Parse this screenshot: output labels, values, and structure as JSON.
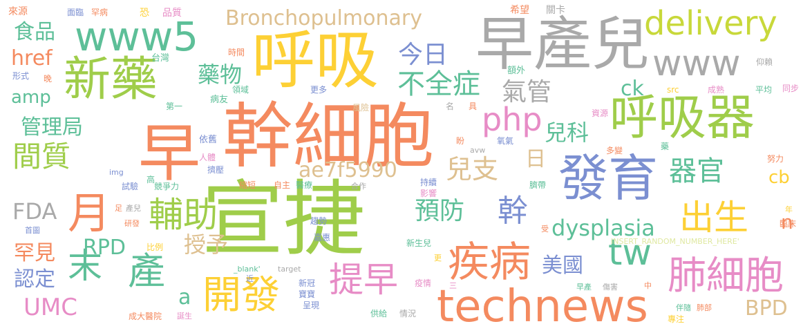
{
  "word_cloud": {
    "words": [
      {
        "text": "幹細胞",
        "color": "#f48a5f"
      },
      {
        "text": "宣捷",
        "color": "#9fcd4a"
      },
      {
        "text": "早產兒",
        "color": "#a9a9a9"
      },
      {
        "text": "呼吸",
        "color": "#fdd035"
      },
      {
        "text": "新藥",
        "color": "#9fcd4a"
      },
      {
        "text": "www5",
        "color": "#5dbf98"
      },
      {
        "text": "www",
        "color": "#a9a9a9"
      },
      {
        "text": "呼吸器",
        "color": "#9fcd4a"
      },
      {
        "text": "發育",
        "color": "#7b8fd1"
      },
      {
        "text": "technews",
        "color": "#f48a5f"
      },
      {
        "text": "早",
        "color": "#f48a5f"
      },
      {
        "text": "delivery",
        "color": "#c8d83a"
      },
      {
        "text": "tw",
        "color": "#5dbf98"
      },
      {
        "text": "疾病",
        "color": "#f48a5f"
      },
      {
        "text": "肺細胞",
        "color": "#e78cc6"
      },
      {
        "text": "開發",
        "color": "#fdd035"
      },
      {
        "text": "輔助",
        "color": "#9fcd4a"
      },
      {
        "text": "器官",
        "color": "#5dbf98"
      },
      {
        "text": "出生",
        "color": "#fdd035"
      },
      {
        "text": "月",
        "color": "#f48a5f"
      },
      {
        "text": "提早",
        "color": "#e78cc6"
      },
      {
        "text": "php",
        "color": "#e78cc6"
      },
      {
        "text": "Bronchopulmonary",
        "color": "#dec090"
      },
      {
        "text": "間質",
        "color": "#9fcd4a"
      },
      {
        "text": "末",
        "color": "#5dbf98"
      },
      {
        "text": "產",
        "color": "#5dbf98"
      },
      {
        "text": "幹",
        "color": "#7b8fd1"
      },
      {
        "text": "不全症",
        "color": "#5dbf98"
      },
      {
        "text": "今日",
        "color": "#7b8fd1"
      },
      {
        "text": "氣管",
        "color": "#a9a9a9"
      },
      {
        "text": "藥物",
        "color": "#5dbf98"
      },
      {
        "text": "dysplasia",
        "color": "#5dbf98"
      },
      {
        "text": "兒支",
        "color": "#dec090"
      },
      {
        "text": "兒科",
        "color": "#5dbf98"
      },
      {
        "text": "ae7f5990",
        "color": "#dec090"
      },
      {
        "text": "預防",
        "color": "#5dbf98"
      },
      {
        "text": "管理局",
        "color": "#5dbf98"
      },
      {
        "text": "美國",
        "color": "#7b8fd1"
      },
      {
        "text": "授予",
        "color": "#dec090"
      },
      {
        "text": "FDA",
        "color": "#a9a9a9"
      },
      {
        "text": "RPD",
        "color": "#5dbf98"
      },
      {
        "text": "UMC",
        "color": "#e78cc6"
      },
      {
        "text": "BPD",
        "color": "#dec090"
      },
      {
        "text": "食品",
        "color": "#5dbf98"
      },
      {
        "text": "href",
        "color": "#f48a5f"
      },
      {
        "text": "amp",
        "color": "#5dbf98"
      },
      {
        "text": "ck",
        "color": "#5dbf98"
      },
      {
        "text": "cb",
        "color": "#fdd035"
      },
      {
        "text": "日",
        "color": "#dec090"
      },
      {
        "text": "罕見",
        "color": "#f48a5f"
      },
      {
        "text": "認定",
        "color": "#7b8fd1"
      },
      {
        "text": "a",
        "color": "#5dbf98"
      },
      {
        "text": "n",
        "color": "#f48a5f"
      },
      {
        "text": "來源",
        "color": "#f48a5f"
      },
      {
        "text": "面臨",
        "color": "#7b8fd1"
      },
      {
        "text": "罕病",
        "color": "#f48a5f"
      },
      {
        "text": "恐",
        "color": "#fdd035"
      },
      {
        "text": "品質",
        "color": "#e78cc6"
      },
      {
        "text": "希望",
        "color": "#f48a5f"
      },
      {
        "text": "關卡",
        "color": "#a9a9a9"
      },
      {
        "text": "台灣",
        "color": "#5dbf98"
      },
      {
        "text": "時間",
        "color": "#f48a5f"
      },
      {
        "text": "仰賴",
        "color": "#a9a9a9"
      },
      {
        "text": "額外",
        "color": "#5dbf98"
      },
      {
        "text": "同步",
        "color": "#e78cc6"
      },
      {
        "text": "形式",
        "color": "#7b8fd1"
      },
      {
        "text": "晚",
        "color": "#f48a5f"
      },
      {
        "text": "病友",
        "color": "#5dbf98"
      },
      {
        "text": "領域",
        "color": "#5dbf98"
      },
      {
        "text": "更多",
        "color": "#7b8fd1"
      },
      {
        "text": "src",
        "color": "#fdd035"
      },
      {
        "text": "成熟",
        "color": "#e78cc6"
      },
      {
        "text": "平均",
        "color": "#5dbf98"
      },
      {
        "text": "第一",
        "color": "#5dbf98"
      },
      {
        "text": "風險",
        "color": "#dec090"
      },
      {
        "text": "名",
        "color": "#a9a9a9"
      },
      {
        "text": "具",
        "color": "#f48a5f"
      },
      {
        "text": "資源",
        "color": "#e78cc6"
      },
      {
        "text": "依舊",
        "color": "#7b8fd1"
      },
      {
        "text": "盼",
        "color": "#f48a5f"
      },
      {
        "text": "氧氣",
        "color": "#7b8fd1"
      },
      {
        "text": "avw",
        "color": "#a9a9a9"
      },
      {
        "text": "多變",
        "color": "#f48a5f"
      },
      {
        "text": "藥",
        "color": "#5dbf98"
      },
      {
        "text": "努力",
        "color": "#f48a5f"
      },
      {
        "text": "人體",
        "color": "#e78cc6"
      },
      {
        "text": "擠壓",
        "color": "#7b8fd1"
      },
      {
        "text": "img",
        "color": "#7b8fd1"
      },
      {
        "text": "高",
        "color": "#5dbf98"
      },
      {
        "text": "競爭力",
        "color": "#5dbf98"
      },
      {
        "text": "試驗",
        "color": "#7b8fd1"
      },
      {
        "text": "縮短",
        "color": "#f48a5f"
      },
      {
        "text": "自主",
        "color": "#f48a5f"
      },
      {
        "text": "醫療",
        "color": "#5dbf98"
      },
      {
        "text": "合作",
        "color": "#a9a9a9"
      },
      {
        "text": "持續",
        "color": "#7b8fd1"
      },
      {
        "text": "影響",
        "color": "#e78cc6"
      },
      {
        "text": "臍帶",
        "color": "#5dbf98"
      },
      {
        "text": "足",
        "color": "#f48a5f"
      },
      {
        "text": "產兒",
        "color": "#a9a9a9"
      },
      {
        "text": "趨勢",
        "color": "#7b8fd1"
      },
      {
        "text": "年",
        "color": "#fdd035"
      },
      {
        "text": "首圖",
        "color": "#7b8fd1"
      },
      {
        "text": "研發",
        "color": "#f48a5f"
      },
      {
        "text": "受",
        "color": "#f48a5f"
      },
      {
        "text": "臨床",
        "color": "#f48a5f"
      },
      {
        "text": "嘉惠",
        "color": "#7b8fd1"
      },
      {
        "text": "INSERT_RANDOM_NUMBER_HERE'",
        "color": "#dfe8a0"
      },
      {
        "text": "新生兒",
        "color": "#5dbf98"
      },
      {
        "text": "比例",
        "color": "#fdd035"
      },
      {
        "text": "更",
        "color": "#fdd035"
      },
      {
        "text": "_blank'",
        "color": "#5dbf98"
      },
      {
        "text": "target",
        "color": "#a9a9a9"
      },
      {
        "text": "近",
        "color": "#7b8fd1"
      },
      {
        "text": "新冠",
        "color": "#7b8fd1"
      },
      {
        "text": "疫情",
        "color": "#e78cc6"
      },
      {
        "text": "三",
        "color": "#e78cc6"
      },
      {
        "text": "早產",
        "color": "#5dbf98"
      },
      {
        "text": "傷害",
        "color": "#a9a9a9"
      },
      {
        "text": "中",
        "color": "#f48a5f"
      },
      {
        "text": "寶寶",
        "color": "#7b8fd1"
      },
      {
        "text": "呈現",
        "color": "#7b8fd1"
      },
      {
        "text": "伴隨",
        "color": "#5dbf98"
      },
      {
        "text": "肺部",
        "color": "#f48a5f"
      },
      {
        "text": "成大醫院",
        "color": "#f48a5f"
      },
      {
        "text": "誕生",
        "color": "#e78cc6"
      },
      {
        "text": "供給",
        "color": "#5dbf98"
      },
      {
        "text": "情況",
        "color": "#a9a9a9"
      },
      {
        "text": "專注",
        "color": "#fdd035"
      }
    ]
  }
}
